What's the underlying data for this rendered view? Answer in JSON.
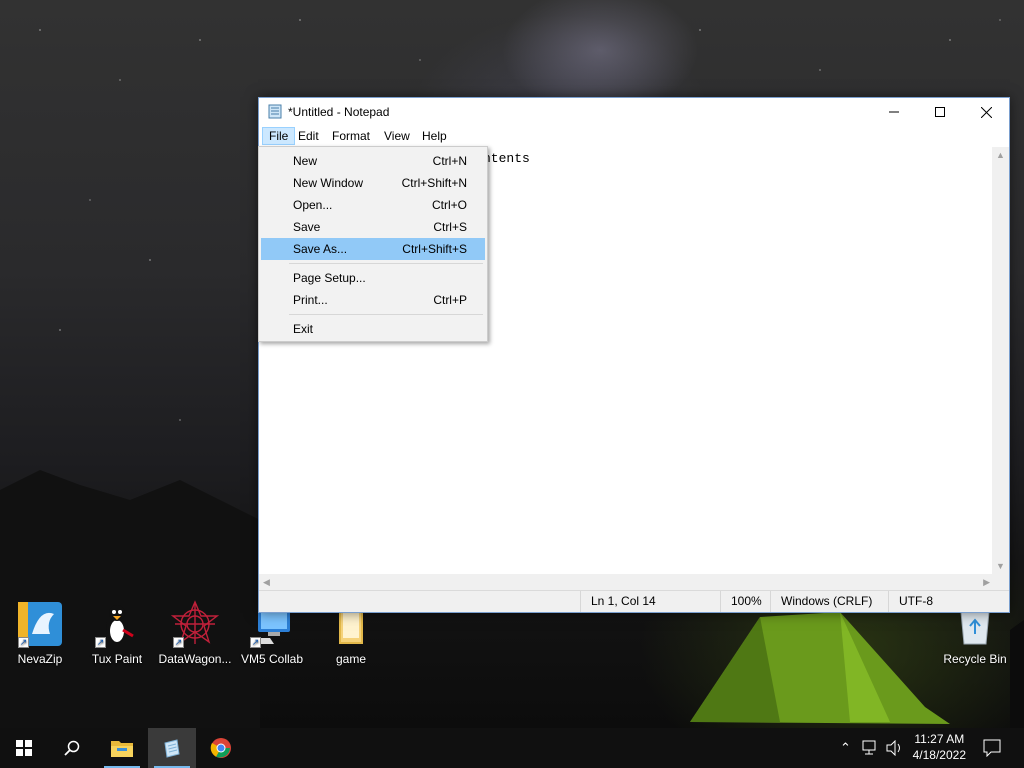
{
  "window": {
    "title": "*Untitled - Notepad",
    "minimize_glyph": "—",
    "maximize_glyph": "☐",
    "close_glyph": "✕"
  },
  "menubar": {
    "items": [
      {
        "label": "File"
      },
      {
        "label": "Edit"
      },
      {
        "label": "Format"
      },
      {
        "label": "View"
      },
      {
        "label": "Help"
      }
    ]
  },
  "editor": {
    "visible_text": "ntents"
  },
  "file_menu": {
    "items": [
      {
        "label": "New",
        "shortcut": "Ctrl+N"
      },
      {
        "label": "New Window",
        "shortcut": "Ctrl+Shift+N"
      },
      {
        "label": "Open...",
        "shortcut": "Ctrl+O"
      },
      {
        "label": "Save",
        "shortcut": "Ctrl+S"
      },
      {
        "label": "Save As...",
        "shortcut": "Ctrl+Shift+S",
        "highlighted": true
      },
      {
        "label": "Page Setup...",
        "shortcut": ""
      },
      {
        "label": "Print...",
        "shortcut": "Ctrl+P"
      },
      {
        "label": "Exit",
        "shortcut": ""
      }
    ]
  },
  "statusbar": {
    "position": "Ln 1, Col 14",
    "zoom": "100%",
    "line_ending": "Windows (CRLF)",
    "encoding": "UTF-8"
  },
  "desktop_icons": [
    {
      "label": "NevaZip",
      "icon": "nevazip-icon"
    },
    {
      "label": "Tux Paint",
      "icon": "tux-paint-icon"
    },
    {
      "label": "DataWagon...",
      "icon": "datawagon-icon"
    },
    {
      "label": "VM5 Collab",
      "icon": "vm5-collab-icon"
    },
    {
      "label": "game",
      "icon": "folder-icon"
    },
    {
      "label": "Recycle Bin",
      "icon": "recycle-bin-icon"
    }
  ],
  "taskbar": {
    "time": "11:27 AM",
    "date": "4/18/2022",
    "apps": [
      "start-icon",
      "search-icon",
      "file-explorer-icon",
      "notepad-icon",
      "chrome-icon"
    ]
  },
  "colors": {
    "menu_highlight": "#91c9f7",
    "active_menu": "#cce8ff",
    "taskbar": "#101010"
  }
}
